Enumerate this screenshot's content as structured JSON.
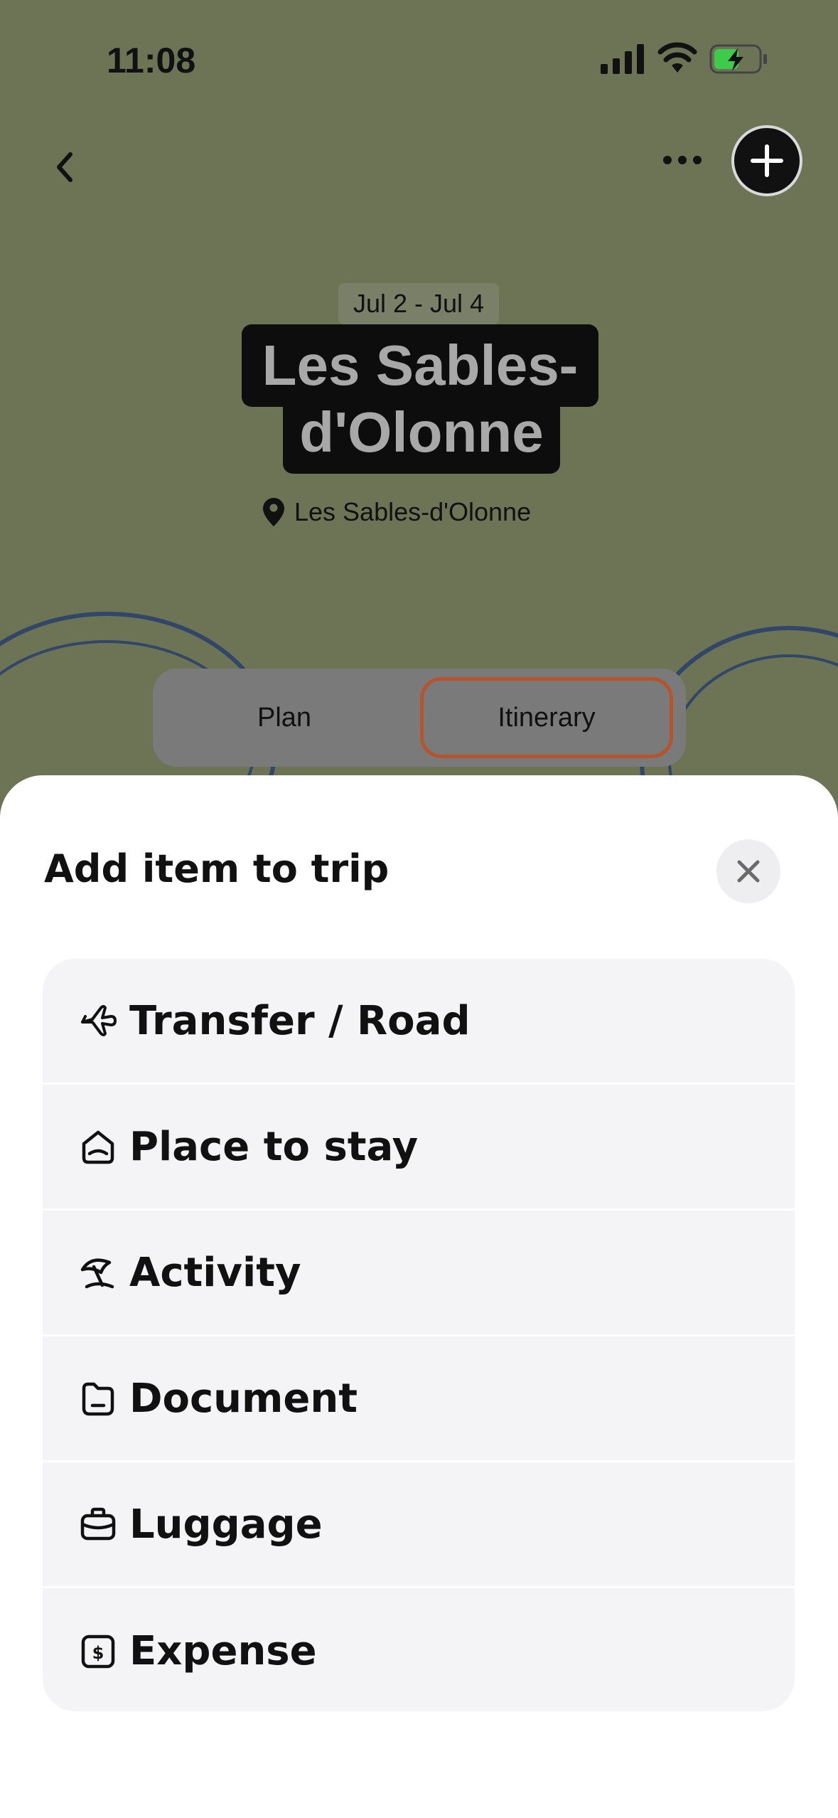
{
  "status_bar": {
    "time": "11:08"
  },
  "header": {
    "back_icon": "chevron-left-icon",
    "more_icon": "ellipsis-icon",
    "add_icon": "plus-icon"
  },
  "trip": {
    "dates": "Jul 2 - Jul 4",
    "title_line1": "Les Sables-",
    "title_line2": "d'Olonne",
    "location": "Les Sables-d'Olonne"
  },
  "tabs": [
    {
      "label": "Plan",
      "selected": false
    },
    {
      "label": "Itinerary",
      "selected": true
    }
  ],
  "sheet": {
    "title": "Add item to trip",
    "close_icon": "close-icon",
    "items": [
      {
        "label": "Transfer / Road",
        "icon": "plane-icon"
      },
      {
        "label": "Place to stay",
        "icon": "house-icon"
      },
      {
        "label": "Activity",
        "icon": "beach-umbrella-icon"
      },
      {
        "label": "Document",
        "icon": "folder-icon"
      },
      {
        "label": "Luggage",
        "icon": "suitcase-icon"
      },
      {
        "label": "Expense",
        "icon": "dollar-icon"
      }
    ]
  },
  "colors": {
    "background": "#6d7456",
    "selected_tab_border": "#b5552e",
    "sheet_background": "#ffffff",
    "menu_background": "#f4f4f6"
  }
}
